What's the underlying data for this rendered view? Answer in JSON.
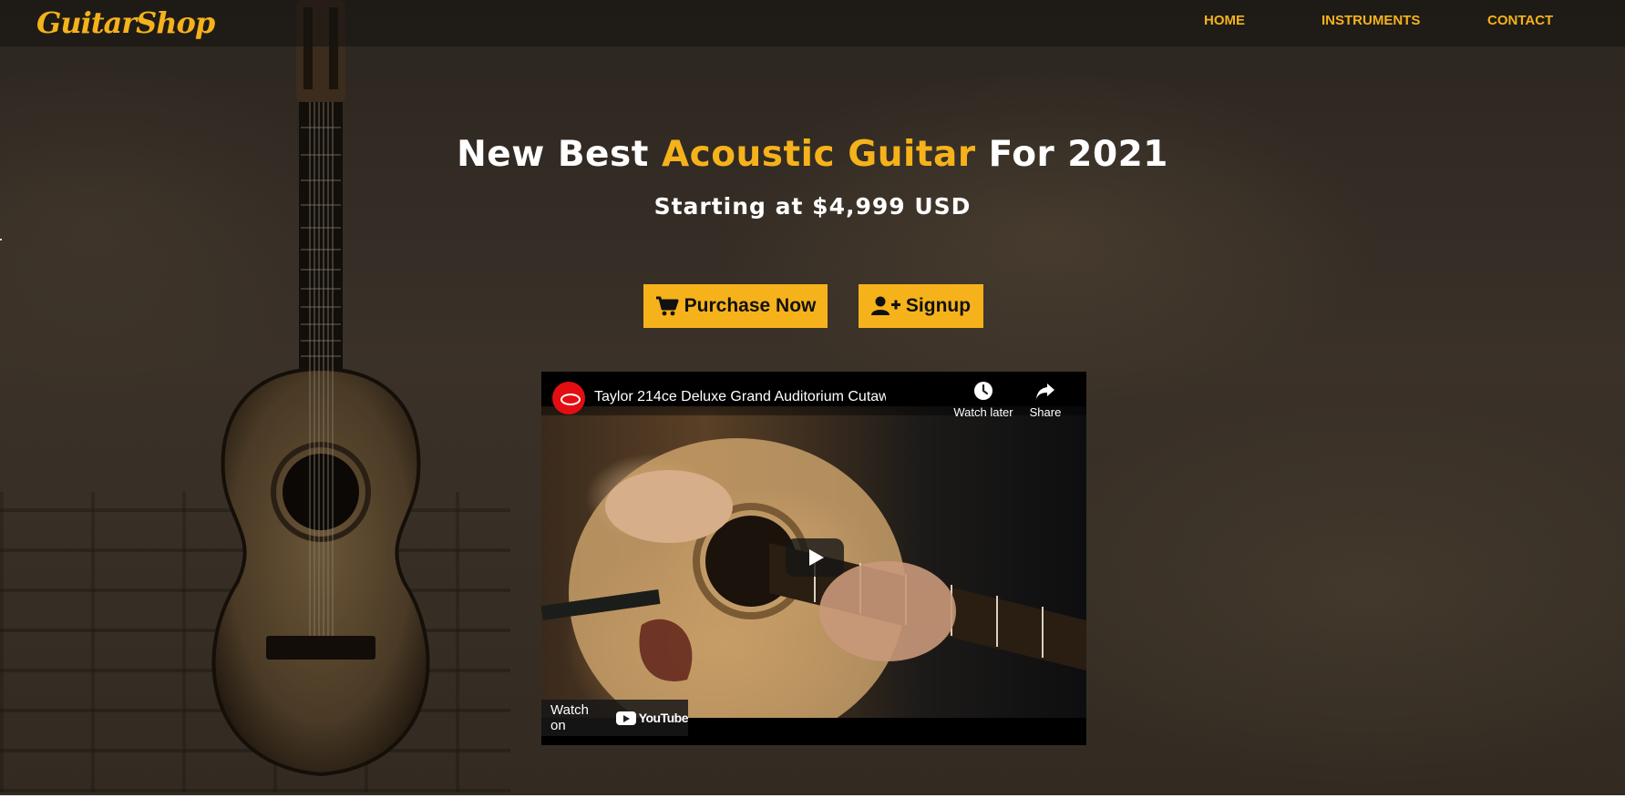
{
  "brand": {
    "name": "GuitarShop"
  },
  "nav": {
    "items": [
      {
        "label": "HOME"
      },
      {
        "label": "INSTRUMENTS"
      },
      {
        "label": "CONTACT"
      }
    ]
  },
  "hero": {
    "headline_pre": "New Best ",
    "headline_accent": "Acoustic Guitar",
    "headline_post": " For 2021",
    "subheadline": "Starting at $4,999 USD",
    "buttons": {
      "purchase": {
        "label": "Purchase Now",
        "icon": "cart-icon"
      },
      "signup": {
        "label": "Signup",
        "icon": "user-plus-icon"
      }
    }
  },
  "video": {
    "title": "Taylor 214ce Deluxe Grand Auditorium Cutaway ...",
    "watch_later_label": "Watch later",
    "share_label": "Share",
    "watch_on_label": "Watch on",
    "youtube_label": "YouTube"
  },
  "colors": {
    "accent": "#f5b21b",
    "navbar": "#1a1714",
    "text": "#ffffff",
    "button_text": "#111111"
  }
}
